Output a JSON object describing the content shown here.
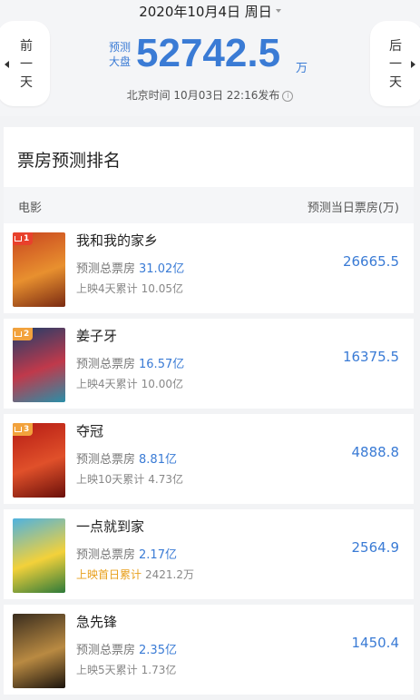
{
  "header": {
    "date": "2020年10月4日 周日",
    "prev_day": "前一天",
    "next_day": "后一天",
    "predicted_label": "预测大盘",
    "total_value": "52742.5",
    "total_unit": "万",
    "publish_time": "北京时间 10月03日 22:16发布",
    "info_icon": "ⓘ"
  },
  "section": {
    "title": "票房预测排名",
    "col_movie": "电影",
    "col_prediction": "预测当日票房(万)"
  },
  "movies": [
    {
      "rank": "1",
      "title": "我和我的家乡",
      "total_label": "预测总票房",
      "total": "31.02亿",
      "cum_label": "上映4天累计",
      "cum": "10.05亿",
      "pred": "26665.5",
      "badge_color": "#e8412c",
      "poster_colors": [
        "#c8451f",
        "#e8902f",
        "#7a2a12"
      ]
    },
    {
      "rank": "2",
      "title": "姜子牙",
      "total_label": "预测总票房",
      "total": "16.57亿",
      "cum_label": "上映4天累计",
      "cum": "10.00亿",
      "pred": "16375.5",
      "badge_color": "#f2a23c",
      "poster_colors": [
        "#1c3e6b",
        "#c0394b",
        "#2a8fa8"
      ]
    },
    {
      "rank": "3",
      "title": "夺冠",
      "total_label": "预测总票房",
      "total": "8.81亿",
      "cum_label": "上映10天累计",
      "cum": "4.73亿",
      "pred": "4888.8",
      "badge_color": "#f2a23c",
      "poster_colors": [
        "#b51b14",
        "#e0502a",
        "#6a0f0a"
      ]
    },
    {
      "rank": "",
      "title": "一点就到家",
      "total_label": "预测总票房",
      "total": "2.17亿",
      "cum_label": "上映首日累计",
      "cum": "2421.2万",
      "pred": "2564.9",
      "badge_color": "",
      "poster_colors": [
        "#4fb2e0",
        "#f3d13a",
        "#2d7a3a"
      ]
    },
    {
      "rank": "",
      "title": "急先锋",
      "total_label": "预测总票房",
      "total": "2.35亿",
      "cum_label": "上映5天累计",
      "cum": "1.73亿",
      "pred": "1450.4",
      "badge_color": "",
      "poster_colors": [
        "#3a2d1e",
        "#b98a42",
        "#1c140d"
      ]
    }
  ],
  "colors": {
    "accent": "#3a7bd5",
    "highlight": "#e8a01d"
  }
}
